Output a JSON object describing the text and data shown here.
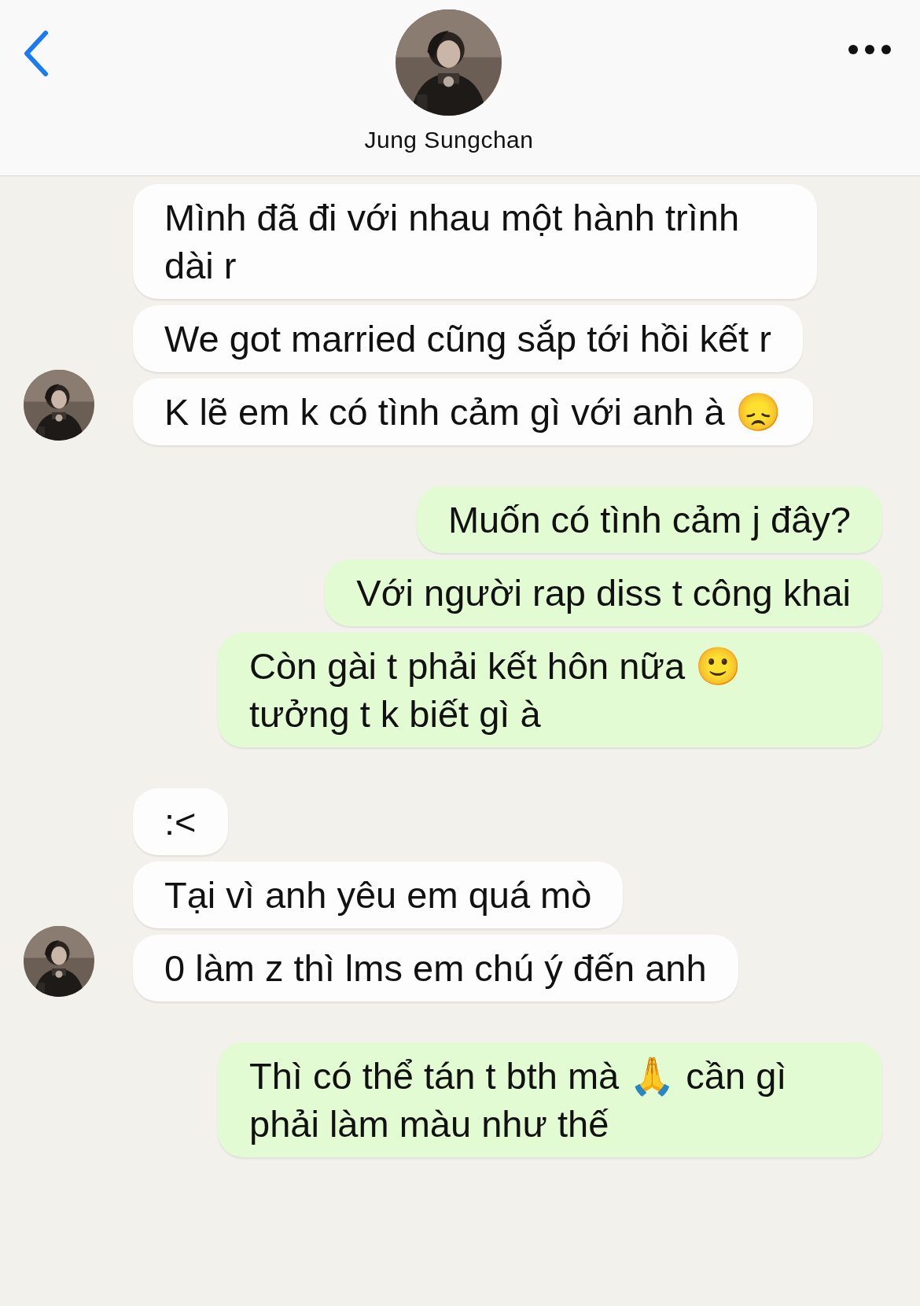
{
  "header": {
    "name": "Jung Sungchan"
  },
  "groups": [
    {
      "kind": "incoming",
      "messages": [
        "Mình đã đi với nhau một hành trình dài r",
        "We got married cũng sắp tới hồi kết r",
        "K lẽ em k có tình cảm gì với anh à 😞"
      ]
    },
    {
      "kind": "outgoing",
      "messages": [
        "Muốn có tình cảm j đây?",
        "Với người rap diss t công khai",
        "Còn gài t phải kết hôn nữa 🙂 tưởng t k biết gì à"
      ]
    },
    {
      "kind": "incoming",
      "messages": [
        ":<",
        "Tại vì anh yêu em quá mò",
        "0 làm z thì lms em chú ý đến anh"
      ]
    },
    {
      "kind": "outgoing",
      "messages": [
        "Thì có thể tán t bth mà 🙏 cần gì phải làm màu như thế"
      ]
    }
  ]
}
